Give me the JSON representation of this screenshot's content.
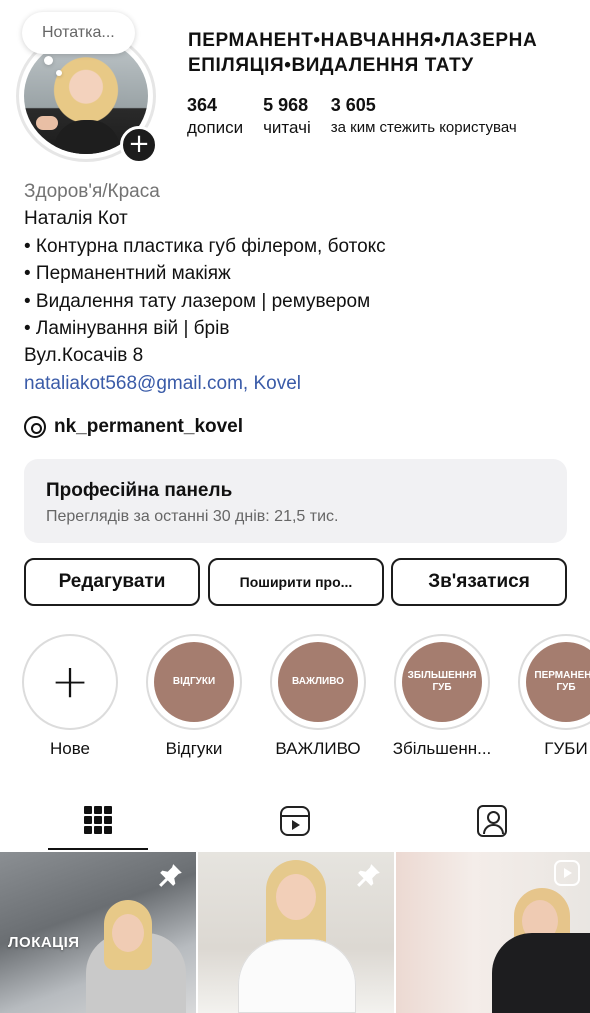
{
  "profile": {
    "note": "Нотатка...",
    "username": "ПЕРМАНЕНТ•НАВЧАННЯ•ЛАЗЕРНА ЕПІЛЯЦІЯ•ВИДАЛЕННЯ ТАТУ",
    "stats": {
      "posts": {
        "value": "364",
        "label": "дописи"
      },
      "followers": {
        "value": "5 968",
        "label": "читачі"
      },
      "following": {
        "value": "3 605",
        "label": "за ким стежить користувач"
      }
    },
    "add_story_symbol": "+"
  },
  "bio": {
    "category": "Здоров'я/Краса",
    "lines": [
      "Наталія Кот",
      "• Контурна пластика губ філером, ботокс",
      "• Перманентний макіяж",
      "• Видалення тату лазером | ремувером",
      "• Ламінування вій | брів",
      "Вул.Косачів 8"
    ],
    "link": "nataliakot568@gmail.com, Kovel",
    "threads_handle": "nk_permanent_kovel"
  },
  "professional_panel": {
    "title": "Професійна панель",
    "subtitle": "Переглядів за останні 30 днів: 21,5 тис."
  },
  "actions": {
    "edit": "Редагувати",
    "share": "Поширити про...",
    "contact": "Зв'язатися"
  },
  "highlights": [
    {
      "label": "Нове",
      "cover_text": ""
    },
    {
      "label": "Відгуки",
      "cover_text": "ВІДГУКИ"
    },
    {
      "label": "ВАЖЛИВО",
      "cover_text": "ВАЖЛИВО"
    },
    {
      "label": "Збільшенн...",
      "cover_text": "ЗБІЛЬШЕННЯ ГУБ"
    },
    {
      "label": "ГУБИ",
      "cover_text": "ПЕРМАНЕНТ ГУБ"
    }
  ],
  "tabs": [
    {
      "name": "grid-icon",
      "active": true
    },
    {
      "name": "reels-icon",
      "active": false
    },
    {
      "name": "tagged-icon",
      "active": false
    }
  ],
  "posts": [
    {
      "caption": "ЛОКАЦІЯ",
      "pinned": true,
      "reel": false
    },
    {
      "caption": "",
      "pinned": true,
      "reel": false
    },
    {
      "caption": "",
      "pinned": false,
      "reel": true
    }
  ],
  "colors": {
    "highlight_cover": "#a57d6f",
    "link": "#3a5ba8",
    "panel_bg": "#f1f1f3"
  }
}
